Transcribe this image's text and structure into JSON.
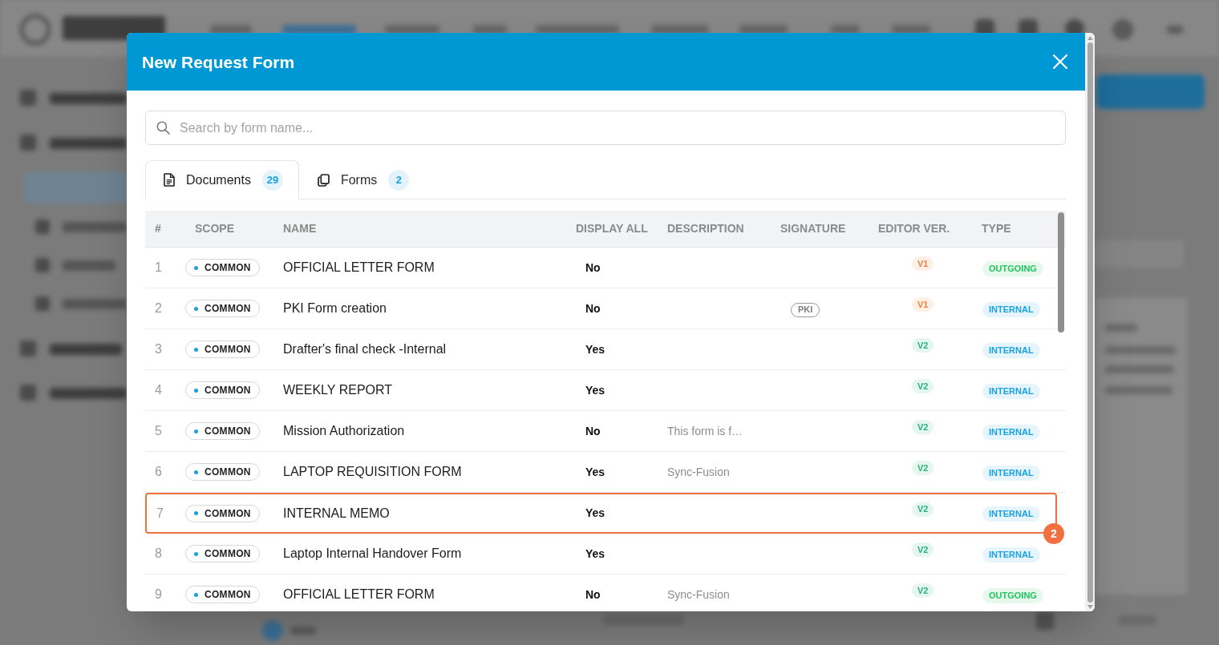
{
  "dialog": {
    "title": "New Request Form"
  },
  "search": {
    "placeholder": "Search by form name..."
  },
  "tabs": [
    {
      "kind": "documents",
      "label": "Documents",
      "count": "29",
      "selected": true
    },
    {
      "kind": "forms",
      "label": "Forms",
      "count": "2",
      "selected": false
    }
  ],
  "table": {
    "columns": [
      "#",
      "SCOPE",
      "NAME",
      "DISPLAY ALL",
      "DESCRIPTION",
      "SIGNATURE",
      "EDITOR VER.",
      "TYPE"
    ],
    "rows": [
      {
        "number": "1",
        "scope": "COMMON",
        "name": "OFFICIAL LETTER FORM",
        "display_all": "No",
        "editor_ver": {
          "text": "V1",
          "color": "#f0803c"
        },
        "type": {
          "text": "OUTGOING",
          "color": "#22c55e"
        },
        "highlighted": false
      },
      {
        "number": "2",
        "scope": "COMMON",
        "name": "PKI Form creation",
        "display_all": "No",
        "signature": "PKI",
        "editor_ver": {
          "text": "V1",
          "color": "#f0803c"
        },
        "type": {
          "text": "INTERNAL",
          "color": "#1ba1e2"
        },
        "highlighted": false
      },
      {
        "number": "3",
        "scope": "COMMON",
        "name": "Drafter's final check -Internal",
        "display_all": "Yes",
        "editor_ver": {
          "text": "V2",
          "color": "#25b47a"
        },
        "type": {
          "text": "INTERNAL",
          "color": "#1ba1e2"
        },
        "highlighted": false
      },
      {
        "number": "4",
        "scope": "COMMON",
        "name": "WEEKLY REPORT",
        "display_all": "Yes",
        "editor_ver": {
          "text": "V2",
          "color": "#25b47a"
        },
        "type": {
          "text": "INTERNAL",
          "color": "#1ba1e2"
        },
        "highlighted": false
      },
      {
        "number": "5",
        "scope": "COMMON",
        "name": "Mission Authorization",
        "display_all": "No",
        "description": "This form is f…",
        "editor_ver": {
          "text": "V2",
          "color": "#25b47a"
        },
        "type": {
          "text": "INTERNAL",
          "color": "#1ba1e2"
        },
        "highlighted": false
      },
      {
        "number": "6",
        "scope": "COMMON",
        "name": "LAPTOP REQUISITION FORM",
        "display_all": "Yes",
        "description": "Sync-Fusion",
        "editor_ver": {
          "text": "V2",
          "color": "#25b47a"
        },
        "type": {
          "text": "INTERNAL",
          "color": "#1ba1e2"
        },
        "highlighted": false
      },
      {
        "number": "7",
        "scope": "COMMON",
        "name": "INTERNAL MEMO",
        "display_all": "Yes",
        "editor_ver": {
          "text": "V2",
          "color": "#25b47a"
        },
        "type": {
          "text": "INTERNAL",
          "color": "#1ba1e2"
        },
        "highlighted": true,
        "callout": "2"
      },
      {
        "number": "8",
        "scope": "COMMON",
        "name": "Laptop Internal Handover Form",
        "display_all": "Yes",
        "editor_ver": {
          "text": "V2",
          "color": "#25b47a"
        },
        "type": {
          "text": "INTERNAL",
          "color": "#1ba1e2"
        },
        "highlighted": false
      },
      {
        "number": "9",
        "scope": "COMMON",
        "name": "OFFICIAL LETTER FORM",
        "display_all": "No",
        "description": "Sync-Fusion",
        "editor_ver": {
          "text": "V2",
          "color": "#25b47a"
        },
        "type": {
          "text": "OUTGOING",
          "color": "#22c55e"
        },
        "highlighted": false
      }
    ]
  }
}
